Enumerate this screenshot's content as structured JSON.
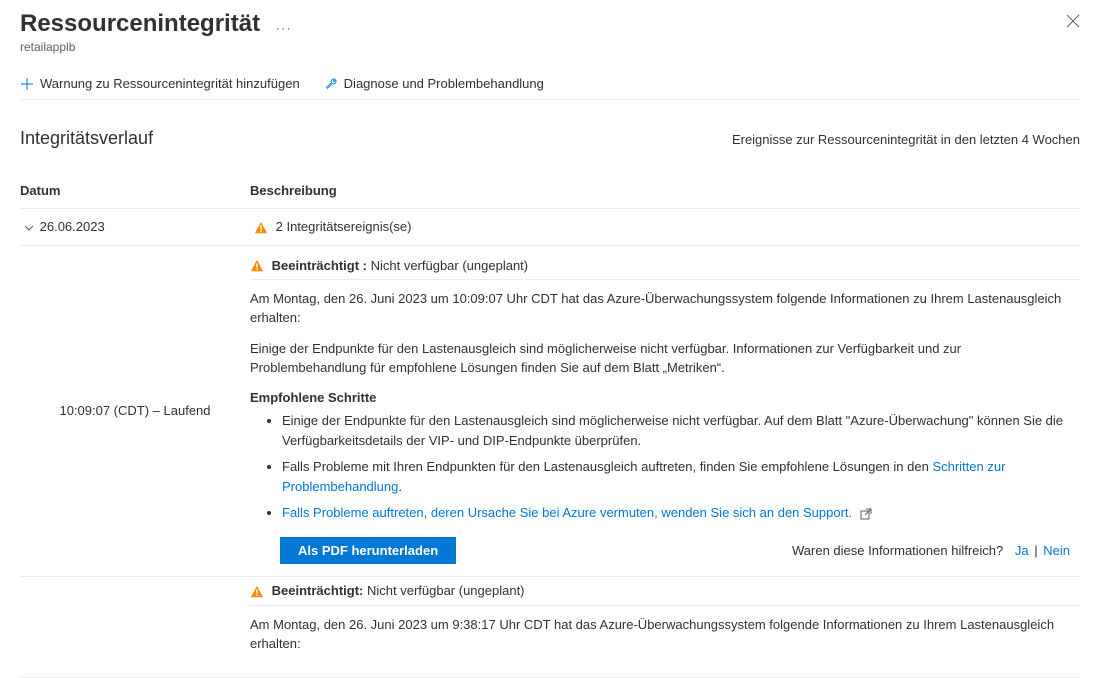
{
  "header": {
    "title": "Ressourcenintegrität",
    "subtitle": "retailapplb",
    "more_label": "···"
  },
  "toolbar": {
    "add_alert_label": "Warnung zu Ressourcenintegrität hinzufügen",
    "diagnose_label": "Diagnose und Problembehandlung"
  },
  "section": {
    "title": "Integritätsverlauf",
    "meta": "Ereignisse zur Ressourcenintegrität in den letzten 4 Wochen"
  },
  "table": {
    "col_date": "Datum",
    "col_desc": "Beschreibung",
    "rows": [
      {
        "date": "26.06.2023",
        "desc": "2 Integritätsereignis(se)"
      }
    ]
  },
  "event1": {
    "time": "10:09:07 (CDT)  – Laufend",
    "status": "Beeinträchtigt :",
    "status_detail": "Nicht verfügbar (ungeplant)",
    "line1": "Am Montag, den 26. Juni 2023 um 10:09:07 Uhr CDT hat das Azure-Überwachungssystem folgende Informationen zu Ihrem Lastenausgleich erhalten:",
    "line2": "Einige der Endpunkte für den Lastenausgleich sind möglicherweise nicht verfügbar. Informationen zur Verfügbarkeit und zur Problembehandlung für empfohlene Lösungen finden Sie auf dem Blatt „Metriken“.",
    "steps_head": "Empfohlene Schritte",
    "step1": "Einige der Endpunkte für den Lastenausgleich sind möglicherweise nicht verfügbar. Auf dem Blatt \"Azure-Überwachung\" können Sie die Verfügbarkeitsdetails der VIP- und DIP-Endpunkte überprüfen.",
    "step2_a": "Falls Probleme mit Ihren Endpunkten für den Lastenausgleich auftreten, finden Sie empfohlene Lösungen in den ",
    "step2_link": "Schritten zur Problembehandlung",
    "step2_b": ".",
    "step3_link": "Falls Probleme auftreten, deren Ursache Sie bei Azure vermuten, wenden Sie sich an den Support.",
    "pdf_label": "Als PDF herunterladen",
    "feedback_q": "Waren diese Informationen hilfreich?",
    "yes": "Ja",
    "no": "Nein"
  },
  "event2": {
    "status": "Beeinträchtigt:",
    "status_detail": "Nicht verfügbar (ungeplant)",
    "line1": "Am Montag, den 26. Juni 2023 um 9:38:17 Uhr CDT hat das Azure-Überwachungssystem folgende Informationen zu Ihrem Lastenausgleich erhalten:"
  }
}
